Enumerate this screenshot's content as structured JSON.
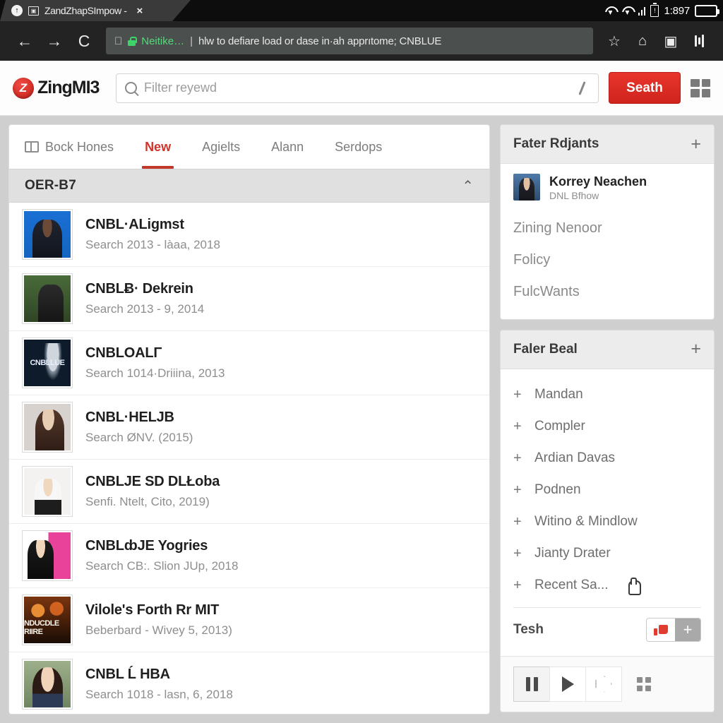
{
  "status_bar": {
    "tab_title": "ZandZhapSImpow -",
    "close_label": "×",
    "clock": "1:897",
    "favicon_glyph": "↑",
    "cast_glyph": "▣"
  },
  "omnibox": {
    "back_glyph": "←",
    "forward_glyph": "→",
    "reload_glyph": "C",
    "apple_glyph": "",
    "secure_label": "Neitike…",
    "separator": "|",
    "url_text": "hlw to defiare load or dase in·ah apprıtome; CNBLUE",
    "star_glyph": "☆",
    "home_glyph": "⌂",
    "clipboard_glyph": "▣"
  },
  "site_header": {
    "logo_mark": "Z",
    "logo_text": "ZingMI3",
    "search_placeholder": "Filter reyewd",
    "search_value": "",
    "search_button": "Seath"
  },
  "tabs": [
    {
      "label": "Bock Hones",
      "active": false,
      "has_icon": true
    },
    {
      "label": "New",
      "active": true,
      "has_icon": false
    },
    {
      "label": "Agielts",
      "active": false,
      "has_icon": false
    },
    {
      "label": "Alann",
      "active": false,
      "has_icon": false
    },
    {
      "label": "Serdops",
      "active": false,
      "has_icon": false
    }
  ],
  "group": {
    "title": "OER-B7",
    "collapse_glyph": "⌃"
  },
  "songs": [
    {
      "title": "CNBL·ALigmst",
      "sub": "Search 2013 - làaa, 2018",
      "art": "art-a",
      "art_label": ""
    },
    {
      "title": "CNBLɃ· Dekrein",
      "sub": "Search 2013 - 9, 2014",
      "art": "art-b",
      "art_label": ""
    },
    {
      "title": "CNBLOALΓ",
      "sub": "Search 1014·Driiina, 2013",
      "art": "art-c",
      "art_label": "CNBLLUE"
    },
    {
      "title": "CNBL·HELJB",
      "sub": "Search ØNV. (2015)",
      "art": "art-d",
      "art_label": ""
    },
    {
      "title": "CNBLJE SD DLŁoba",
      "sub": "Senfi. Ntelt, Cito, 2019)",
      "art": "art-e",
      "art_label": ""
    },
    {
      "title": "CNBLȸJE Yogries",
      "sub": "Search CB:. Slion JUp, 2018",
      "art": "art-f",
      "art_label": ""
    },
    {
      "title": "Vilole's Forth Rr MIT",
      "sub": "Beberbard - Wivey 5, 2013)",
      "art": "art-g",
      "art_label": "NDUCDLE RIIRE"
    },
    {
      "title": "CNBL Ĺ HBA",
      "sub": "Search 1018 - lasn, 6, 2018",
      "art": "art-h",
      "art_label": ""
    }
  ],
  "friends_card": {
    "title": "Fater Rdjants",
    "add_glyph": "+",
    "friend": {
      "name": "Korrey Neachen",
      "sub": "DNL Bfhow"
    },
    "links": [
      "Zining Nenoor",
      "Folicy",
      "FulcWants"
    ]
  },
  "beat_card": {
    "title": "Faler Beal",
    "add_glyph": "+",
    "items": [
      "Mandan",
      "Compler",
      "Ardian Davas",
      "Podnen",
      "Witino & Mindlow",
      "Jianty Drater",
      "Recent Sa..."
    ],
    "item_prefix": "+",
    "footer_label": "Tesh",
    "footer_plus": "+"
  },
  "player": {
    "pause_label": "pause",
    "play_label": "play",
    "next_label": "next",
    "more_label": "more"
  },
  "colors": {
    "accent_red": "#cf241c",
    "tab_active_red": "#d2332b",
    "secure_green": "#3fd46a"
  }
}
